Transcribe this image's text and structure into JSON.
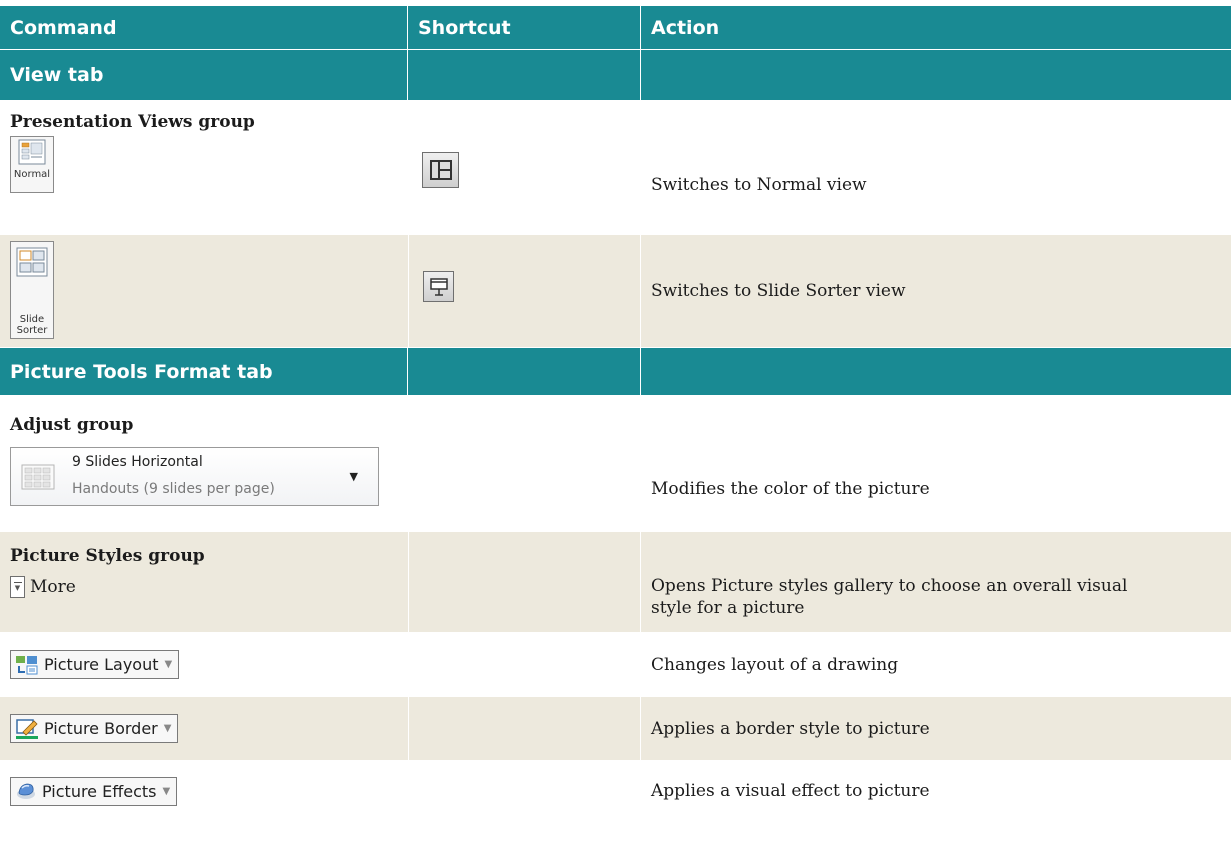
{
  "header": {
    "command": "Command",
    "shortcut": "Shortcut",
    "action": "Action"
  },
  "view_tab": {
    "title": "View tab"
  },
  "presentation_views": {
    "group": "Presentation Views group",
    "normal": {
      "button_label": "Normal",
      "action": "Switches to Normal view"
    },
    "slide_sorter": {
      "button_label_1": "Slide",
      "button_label_2": "Sorter",
      "action": "Switches to Slide Sorter view"
    }
  },
  "picture_tools": {
    "title": "Picture Tools Format tab"
  },
  "adjust": {
    "group": "Adjust group",
    "gallery_title": "9 Slides Horizontal",
    "gallery_sub": "Handouts (9 slides per page)",
    "action": "Modifies the color of the picture"
  },
  "picture_styles": {
    "group": "Picture Styles group",
    "more_label": "More",
    "action": "Opens Picture styles gallery to choose an overall visual style for a picture"
  },
  "picture_layout": {
    "label": "Picture Layout",
    "action": "Changes layout of a drawing"
  },
  "picture_border": {
    "label": "Picture Border",
    "action": "Applies a border style to picture"
  },
  "picture_effects": {
    "label": "Picture Effects",
    "action": "Applies a visual effect to picture"
  },
  "colors": {
    "header_teal": "#198a93",
    "beige": "#ede9dd"
  }
}
